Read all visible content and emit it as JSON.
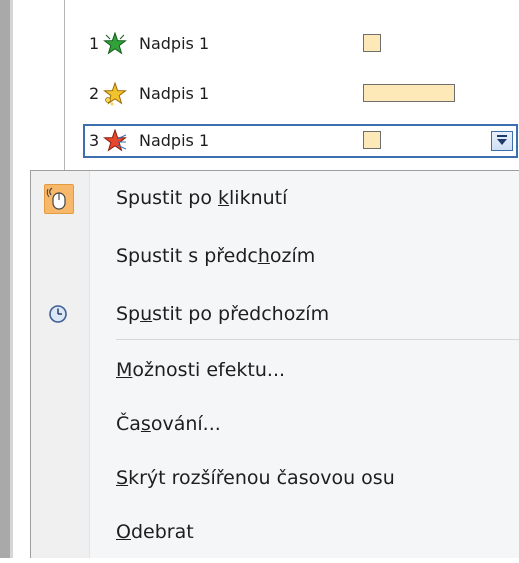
{
  "animation_list": [
    {
      "number": "1",
      "label": "Nadpis 1",
      "icon": "star-green-icon"
    },
    {
      "number": "2",
      "label": "Nadpis 1",
      "icon": "star-gold-sparkle-icon"
    },
    {
      "number": "3",
      "label": "Nadpis 1",
      "icon": "star-red-fly-icon"
    }
  ],
  "context_menu": {
    "items": [
      {
        "pre": "Spustit po ",
        "u": "k",
        "post": "liknutí",
        "icon": "mouse-click-icon"
      },
      {
        "pre": "Spustit s předc",
        "u": "h",
        "post": "ozím",
        "icon": ""
      },
      {
        "pre": "Sp",
        "u": "u",
        "post": "stit po předchozím",
        "icon": "clock-icon"
      },
      {
        "pre": "",
        "u": "M",
        "post": "ožnosti efektu...",
        "icon": ""
      },
      {
        "pre": "Ča",
        "u": "s",
        "post": "ování...",
        "icon": ""
      },
      {
        "pre": "",
        "u": "S",
        "post": "krýt rozšířenou časovou osu",
        "icon": ""
      },
      {
        "pre": "",
        "u": "O",
        "post": "debrat",
        "icon": ""
      }
    ]
  },
  "colors": {
    "selection_border": "#3d6fb0",
    "timing_bar_fill": "#fde8b8",
    "active_icon_bg": "#f8b86a"
  }
}
